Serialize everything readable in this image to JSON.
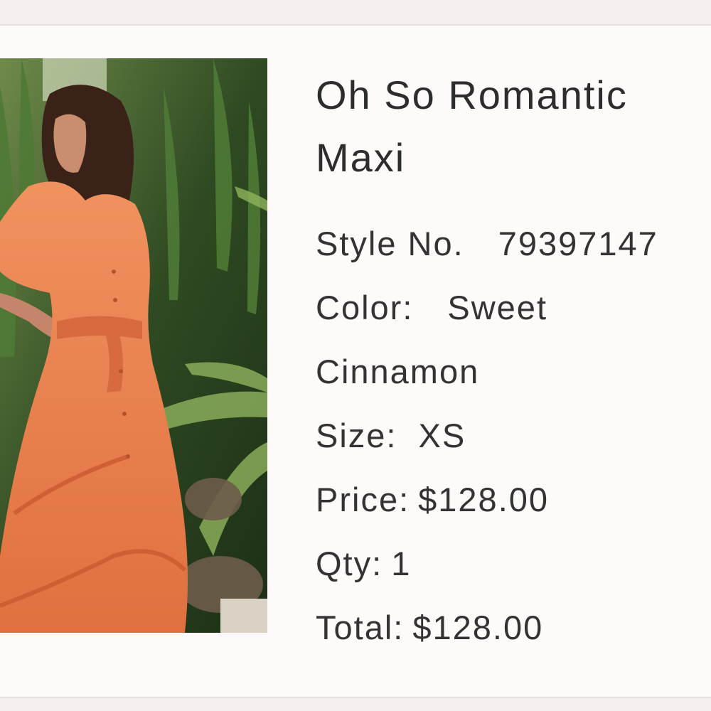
{
  "product": {
    "title_line1": "Oh So Romantic",
    "title_line2": "Maxi",
    "style_label": "Style No.",
    "style_value": "79397147",
    "color_label": "Color:",
    "color_value_line1": "Sweet",
    "color_value_line2": "Cinnamon",
    "size_label": "Size:",
    "size_value": "XS",
    "price_label": "Price:",
    "price_value": "$128.00",
    "qty_label": "Qty:",
    "qty_value": "1",
    "total_label": "Total:",
    "total_value": "$128.00"
  },
  "colors": {
    "card_background": "#fdfaf9",
    "page_background": "#f4efed",
    "text": "#2d2d2d",
    "dress": "#e9865a"
  }
}
